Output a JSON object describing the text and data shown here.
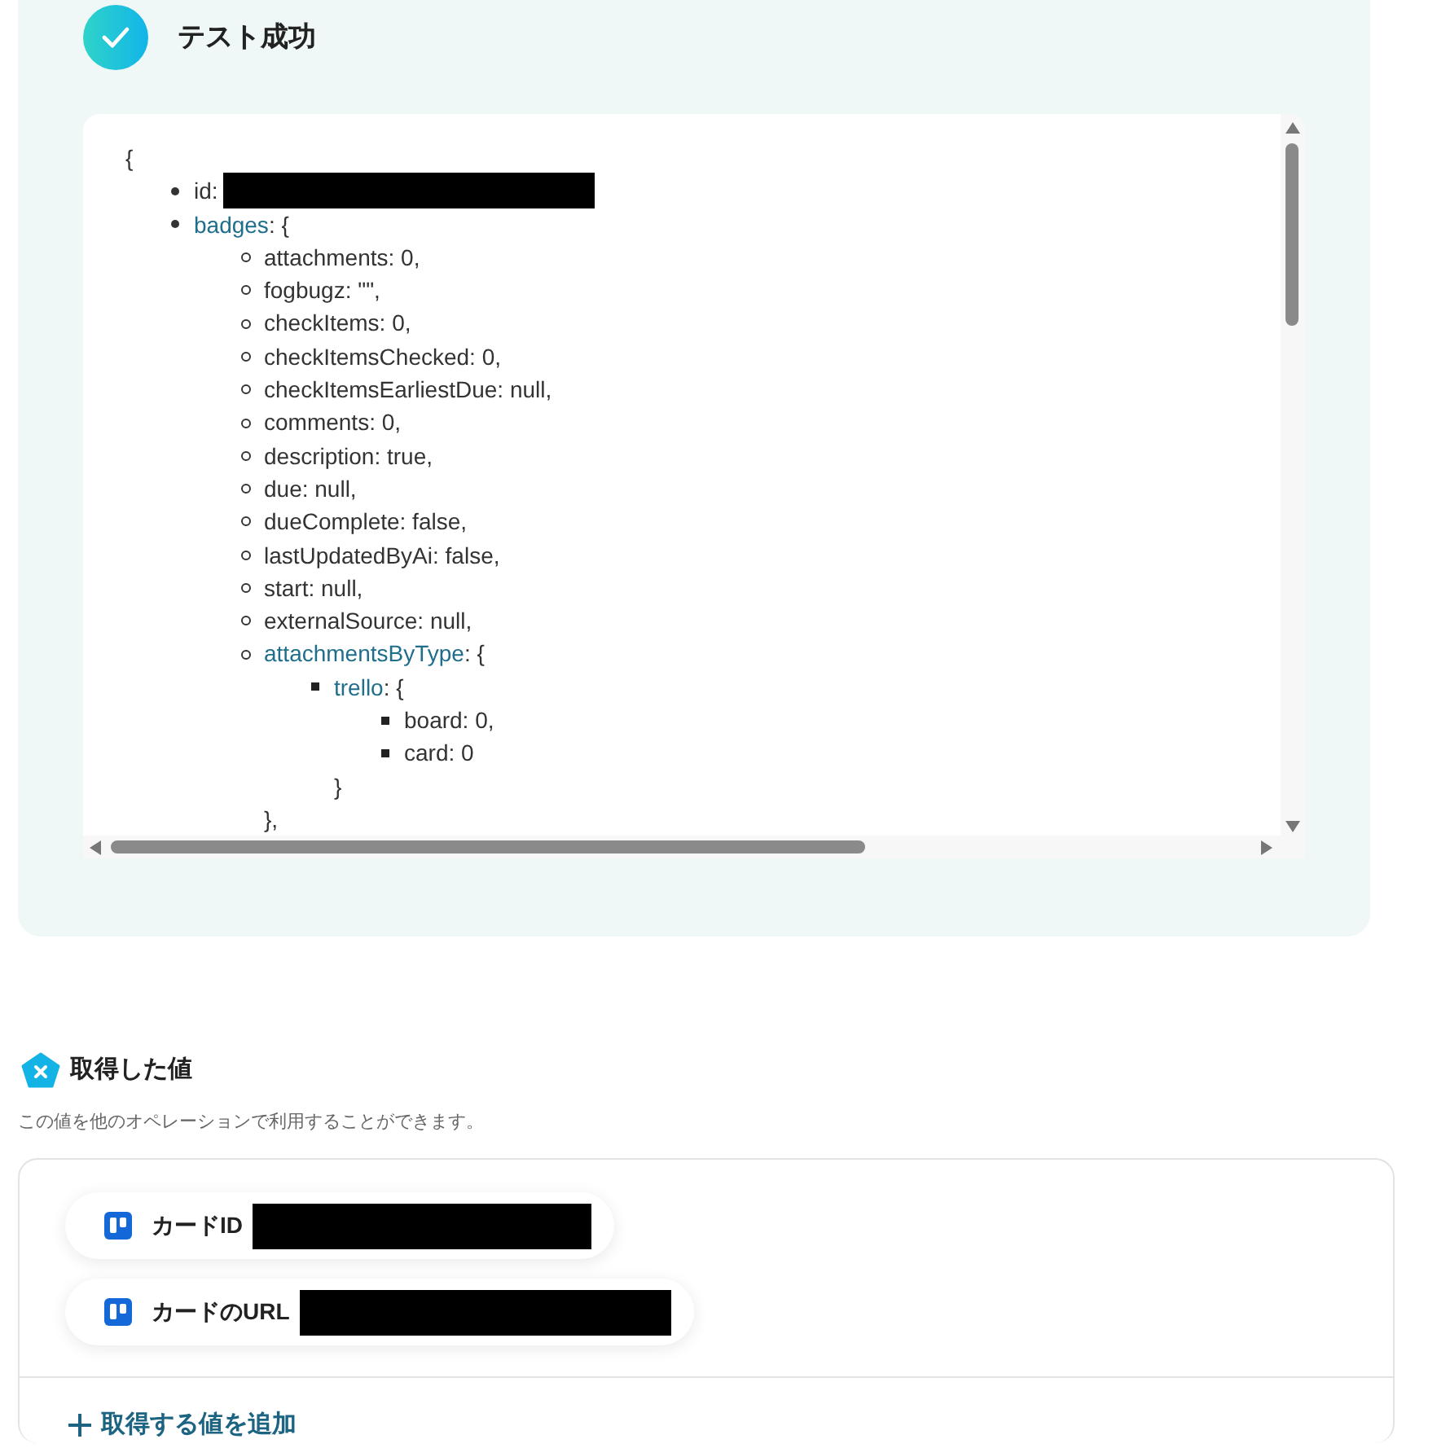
{
  "result": {
    "title": "テスト成功",
    "code": {
      "open": "{",
      "items": [
        {
          "kind": "field",
          "text": "id:",
          "redacted": true
        },
        {
          "kind": "object",
          "key": "badges",
          "open": ": {",
          "children": [
            {
              "kind": "field",
              "text": "attachments: 0,"
            },
            {
              "kind": "field",
              "text": "fogbugz: \"\","
            },
            {
              "kind": "field",
              "text": "checkItems: 0,"
            },
            {
              "kind": "field",
              "text": "checkItemsChecked: 0,"
            },
            {
              "kind": "field",
              "text": "checkItemsEarliestDue: null,"
            },
            {
              "kind": "field",
              "text": "comments: 0,"
            },
            {
              "kind": "field",
              "text": "description: true,"
            },
            {
              "kind": "field",
              "text": "due: null,"
            },
            {
              "kind": "field",
              "text": "dueComplete: false,"
            },
            {
              "kind": "field",
              "text": "lastUpdatedByAi: false,"
            },
            {
              "kind": "field",
              "text": "start: null,"
            },
            {
              "kind": "field",
              "text": "externalSource: null,"
            },
            {
              "kind": "object",
              "key": "attachmentsByType",
              "open": ": {",
              "close": "},",
              "children": [
                {
                  "kind": "object",
                  "key": "trello",
                  "open": ": {",
                  "close": "}",
                  "children": [
                    {
                      "kind": "field",
                      "text": "board: 0,"
                    },
                    {
                      "kind": "field",
                      "text": "card: 0"
                    }
                  ]
                }
              ]
            }
          ]
        }
      ]
    }
  },
  "values": {
    "title": "取得した値",
    "description": "この値を他のオペレーションで利用することができます。",
    "items": [
      {
        "label": "カードID",
        "redacted": true
      },
      {
        "label": "カードのURL",
        "redacted": true
      }
    ],
    "add_link": "取得する値を追加"
  }
}
